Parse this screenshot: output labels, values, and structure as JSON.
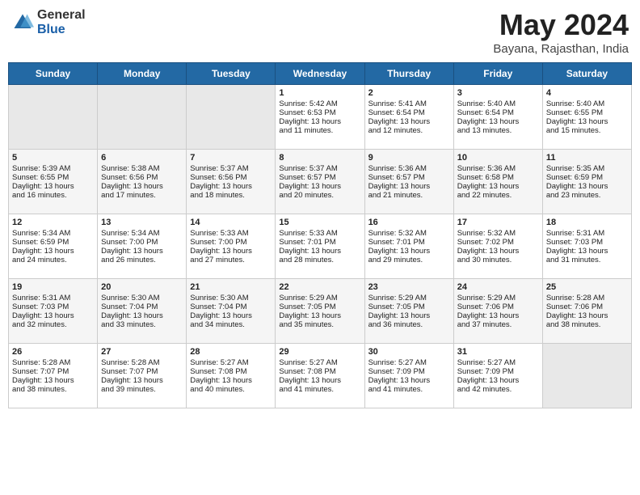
{
  "header": {
    "logo_general": "General",
    "logo_blue": "Blue",
    "title": "May 2024",
    "subtitle": "Bayana, Rajasthan, India"
  },
  "days_of_week": [
    "Sunday",
    "Monday",
    "Tuesday",
    "Wednesday",
    "Thursday",
    "Friday",
    "Saturday"
  ],
  "weeks": [
    {
      "days": [
        {
          "num": "",
          "data": "",
          "empty": true
        },
        {
          "num": "",
          "data": "",
          "empty": true
        },
        {
          "num": "",
          "data": "",
          "empty": true
        },
        {
          "num": "1",
          "data": "Sunrise: 5:42 AM\nSunset: 6:53 PM\nDaylight: 13 hours\nand 11 minutes.",
          "empty": false
        },
        {
          "num": "2",
          "data": "Sunrise: 5:41 AM\nSunset: 6:54 PM\nDaylight: 13 hours\nand 12 minutes.",
          "empty": false
        },
        {
          "num": "3",
          "data": "Sunrise: 5:40 AM\nSunset: 6:54 PM\nDaylight: 13 hours\nand 13 minutes.",
          "empty": false
        },
        {
          "num": "4",
          "data": "Sunrise: 5:40 AM\nSunset: 6:55 PM\nDaylight: 13 hours\nand 15 minutes.",
          "empty": false
        }
      ]
    },
    {
      "days": [
        {
          "num": "5",
          "data": "Sunrise: 5:39 AM\nSunset: 6:55 PM\nDaylight: 13 hours\nand 16 minutes.",
          "empty": false
        },
        {
          "num": "6",
          "data": "Sunrise: 5:38 AM\nSunset: 6:56 PM\nDaylight: 13 hours\nand 17 minutes.",
          "empty": false
        },
        {
          "num": "7",
          "data": "Sunrise: 5:37 AM\nSunset: 6:56 PM\nDaylight: 13 hours\nand 18 minutes.",
          "empty": false
        },
        {
          "num": "8",
          "data": "Sunrise: 5:37 AM\nSunset: 6:57 PM\nDaylight: 13 hours\nand 20 minutes.",
          "empty": false
        },
        {
          "num": "9",
          "data": "Sunrise: 5:36 AM\nSunset: 6:57 PM\nDaylight: 13 hours\nand 21 minutes.",
          "empty": false
        },
        {
          "num": "10",
          "data": "Sunrise: 5:36 AM\nSunset: 6:58 PM\nDaylight: 13 hours\nand 22 minutes.",
          "empty": false
        },
        {
          "num": "11",
          "data": "Sunrise: 5:35 AM\nSunset: 6:59 PM\nDaylight: 13 hours\nand 23 minutes.",
          "empty": false
        }
      ]
    },
    {
      "days": [
        {
          "num": "12",
          "data": "Sunrise: 5:34 AM\nSunset: 6:59 PM\nDaylight: 13 hours\nand 24 minutes.",
          "empty": false
        },
        {
          "num": "13",
          "data": "Sunrise: 5:34 AM\nSunset: 7:00 PM\nDaylight: 13 hours\nand 26 minutes.",
          "empty": false
        },
        {
          "num": "14",
          "data": "Sunrise: 5:33 AM\nSunset: 7:00 PM\nDaylight: 13 hours\nand 27 minutes.",
          "empty": false
        },
        {
          "num": "15",
          "data": "Sunrise: 5:33 AM\nSunset: 7:01 PM\nDaylight: 13 hours\nand 28 minutes.",
          "empty": false
        },
        {
          "num": "16",
          "data": "Sunrise: 5:32 AM\nSunset: 7:01 PM\nDaylight: 13 hours\nand 29 minutes.",
          "empty": false
        },
        {
          "num": "17",
          "data": "Sunrise: 5:32 AM\nSunset: 7:02 PM\nDaylight: 13 hours\nand 30 minutes.",
          "empty": false
        },
        {
          "num": "18",
          "data": "Sunrise: 5:31 AM\nSunset: 7:03 PM\nDaylight: 13 hours\nand 31 minutes.",
          "empty": false
        }
      ]
    },
    {
      "days": [
        {
          "num": "19",
          "data": "Sunrise: 5:31 AM\nSunset: 7:03 PM\nDaylight: 13 hours\nand 32 minutes.",
          "empty": false
        },
        {
          "num": "20",
          "data": "Sunrise: 5:30 AM\nSunset: 7:04 PM\nDaylight: 13 hours\nand 33 minutes.",
          "empty": false
        },
        {
          "num": "21",
          "data": "Sunrise: 5:30 AM\nSunset: 7:04 PM\nDaylight: 13 hours\nand 34 minutes.",
          "empty": false
        },
        {
          "num": "22",
          "data": "Sunrise: 5:29 AM\nSunset: 7:05 PM\nDaylight: 13 hours\nand 35 minutes.",
          "empty": false
        },
        {
          "num": "23",
          "data": "Sunrise: 5:29 AM\nSunset: 7:05 PM\nDaylight: 13 hours\nand 36 minutes.",
          "empty": false
        },
        {
          "num": "24",
          "data": "Sunrise: 5:29 AM\nSunset: 7:06 PM\nDaylight: 13 hours\nand 37 minutes.",
          "empty": false
        },
        {
          "num": "25",
          "data": "Sunrise: 5:28 AM\nSunset: 7:06 PM\nDaylight: 13 hours\nand 38 minutes.",
          "empty": false
        }
      ]
    },
    {
      "days": [
        {
          "num": "26",
          "data": "Sunrise: 5:28 AM\nSunset: 7:07 PM\nDaylight: 13 hours\nand 38 minutes.",
          "empty": false
        },
        {
          "num": "27",
          "data": "Sunrise: 5:28 AM\nSunset: 7:07 PM\nDaylight: 13 hours\nand 39 minutes.",
          "empty": false
        },
        {
          "num": "28",
          "data": "Sunrise: 5:27 AM\nSunset: 7:08 PM\nDaylight: 13 hours\nand 40 minutes.",
          "empty": false
        },
        {
          "num": "29",
          "data": "Sunrise: 5:27 AM\nSunset: 7:08 PM\nDaylight: 13 hours\nand 41 minutes.",
          "empty": false
        },
        {
          "num": "30",
          "data": "Sunrise: 5:27 AM\nSunset: 7:09 PM\nDaylight: 13 hours\nand 41 minutes.",
          "empty": false
        },
        {
          "num": "31",
          "data": "Sunrise: 5:27 AM\nSunset: 7:09 PM\nDaylight: 13 hours\nand 42 minutes.",
          "empty": false
        },
        {
          "num": "",
          "data": "",
          "empty": true
        }
      ]
    }
  ]
}
